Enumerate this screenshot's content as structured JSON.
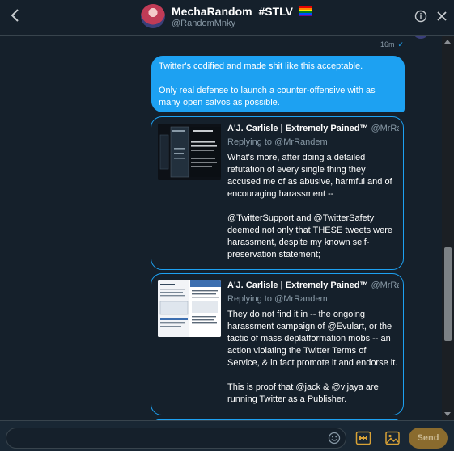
{
  "header": {
    "name": "MechaRandom",
    "tag": "#STLV",
    "handle": "@RandomMnky"
  },
  "conversation": {
    "timestamp": "16m",
    "read_mark": "✓",
    "sent_message": {
      "line1": "Twitter's codified and made shit like this acceptable.",
      "line2": "Only real defense to launch a counter-offensive with as many open salvos as possible."
    },
    "tweets": [
      {
        "author": "A'J. Carlisle | Extremely Pained™",
        "handle": "@MrRa...",
        "replying": "Replying to @MrRandem",
        "text": "What's more, after doing a detailed refutation of every single thing they accused me of as abusive, harmful and of encouraging harassment --\n\n@TwitterSupport and @TwitterSafety deemed not only that THESE tweets were harassment, despite my known self-preservation statement;"
      },
      {
        "author": "A'J. Carlisle | Extremely Pained™",
        "handle": "@MrRa...",
        "replying": "Replying to @MrRandem",
        "text": "They do not find it in -- the ongoing harassment campaign of @Evulart, or the tactic of mass deplatformation mobs -- an action violating the Twitter Terms of Service, & in fact promote it and endorse it.\n\nThis is proof that @jack & @vijaya are running Twitter as a Publisher."
      }
    ]
  },
  "composer": {
    "placeholder": "",
    "send_label": "Send"
  },
  "colors": {
    "background": "#15202b",
    "accent": "#1da1f2",
    "muted_text": "#8899a6",
    "send_button": "#8a6b2e"
  },
  "icons": [
    "back-arrow-icon",
    "info-icon",
    "close-icon",
    "emoji-icon",
    "gif-icon",
    "image-icon",
    "rainbow-flag-icon"
  ]
}
